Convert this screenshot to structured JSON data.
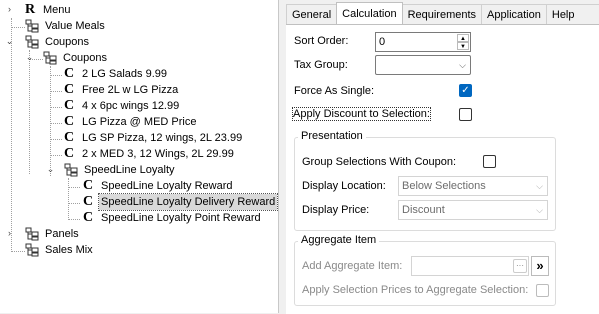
{
  "tree": {
    "items": [
      {
        "label": "Menu",
        "icon": "letter-r-icon",
        "glyph": "R"
      },
      {
        "label": "Value Meals",
        "icon": "folder-tree-icon"
      },
      {
        "label": "Coupons",
        "icon": "folder-tree-icon"
      },
      {
        "label": "Coupons",
        "icon": "folder-tree-icon"
      },
      {
        "label": "2 LG Salads 9.99",
        "icon": "letter-c-icon",
        "glyph": "C"
      },
      {
        "label": "Free 2L w LG Pizza",
        "icon": "letter-c-icon",
        "glyph": "C"
      },
      {
        "label": "4 x 6pc wings 12.99",
        "icon": "letter-c-icon",
        "glyph": "C"
      },
      {
        "label": "LG Pizza @ MED Price",
        "icon": "letter-c-icon",
        "glyph": "C"
      },
      {
        "label": "LG SP Pizza, 12 wings, 2L 23.99",
        "icon": "letter-c-icon",
        "glyph": "C"
      },
      {
        "label": "2 x MED 3, 12 Wings, 2L 29.99",
        "icon": "letter-c-icon",
        "glyph": "C"
      },
      {
        "label": "SpeedLine Loyalty",
        "icon": "folder-tree-icon"
      },
      {
        "label": "SpeedLine Loyalty Reward",
        "icon": "letter-c-icon",
        "glyph": "C"
      },
      {
        "label": "SpeedLine Loyalty Delivery Reward",
        "icon": "letter-c-icon",
        "glyph": "C"
      },
      {
        "label": "SpeedLine Loyalty Point Reward",
        "icon": "letter-c-icon",
        "glyph": "C"
      },
      {
        "label": "Panels",
        "icon": "folder-tree-icon"
      },
      {
        "label": "Sales Mix",
        "icon": "folder-tree-icon"
      }
    ]
  },
  "tabs": [
    "General",
    "Calculation",
    "Requirements",
    "Application",
    "Help Text"
  ],
  "form": {
    "sort_order_label": "Sort Order:",
    "sort_order_value": "0",
    "tax_group_label": "Tax Group:",
    "tax_group_value": "",
    "force_single_label": "Force As Single:",
    "apply_discount_label": "Apply Discount to Selection:",
    "presentation_title": "Presentation",
    "group_selections_label": "Group Selections With Coupon:",
    "display_location_label": "Display Location:",
    "display_location_value": "Below Selections",
    "display_price_label": "Display Price:",
    "display_price_value": "Discount",
    "aggregate_title": "Aggregate Item",
    "add_aggregate_label": "Add Aggregate Item:",
    "browse_label": "···",
    "add_arrow_label": "»",
    "apply_prices_label": "Apply Selection Prices to Aggregate Selection:"
  },
  "colors": {
    "accent": "#0067c0",
    "selection": "#d9d9d9"
  }
}
